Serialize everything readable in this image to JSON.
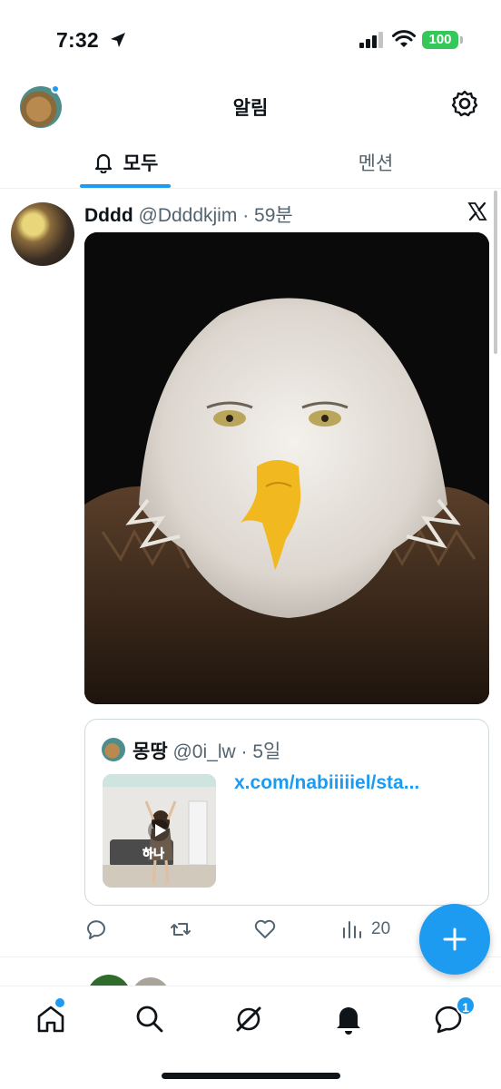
{
  "status_bar": {
    "time": "7:32",
    "battery": "100"
  },
  "header": {
    "title": "알림"
  },
  "tabs": [
    {
      "label": "모두",
      "selected": true
    },
    {
      "label": "멘션",
      "selected": false
    }
  ],
  "tweet": {
    "name": "Dddd",
    "handle": "@Ddddkjim",
    "separator": "·",
    "time": "59분",
    "quote": {
      "name": "몽땅",
      "handle": "@0i_lw",
      "separator": "·",
      "time": "5일",
      "link_text": "x.com/nabiiiiiel/sta...",
      "thumb_caption": "하나"
    },
    "actions": {
      "views": "20"
    }
  },
  "bottom_nav": {
    "messages_badge": "1"
  },
  "colors": {
    "accent": "#1d9bf0",
    "text": "#0f1419",
    "muted": "#536471",
    "battery": "#34c759"
  }
}
